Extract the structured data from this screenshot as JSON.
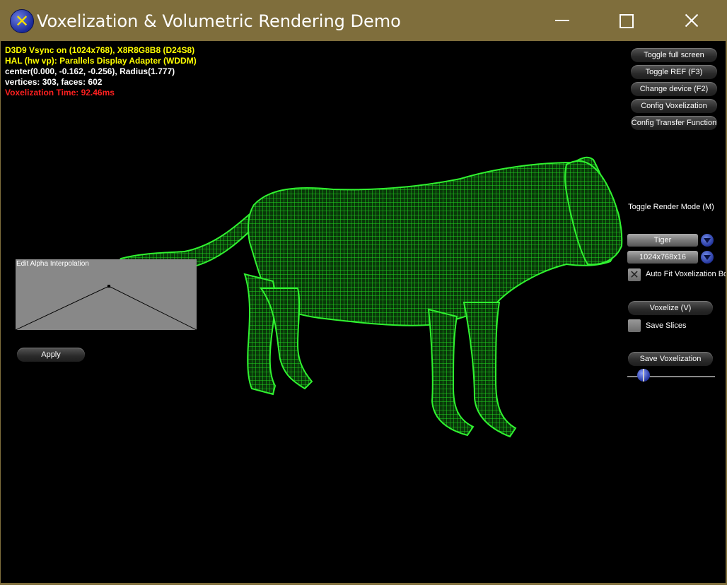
{
  "window": {
    "title": "Voxelization & Volumetric Rendering Demo",
    "icon": "directx-sdk-icon",
    "controls": {
      "minimize": "minimize-icon",
      "maximize": "maximize-icon",
      "close": "close-icon"
    }
  },
  "stats": {
    "device": "D3D9 Vsync on (1024x768), X8R8G8B8 (D24S8)",
    "adapter": "HAL (hw vp): Parallels Display Adapter (WDDM)",
    "bounds": "center(0.000, -0.162, -0.256), Radius(1.777)",
    "geometry": "vertices: 303, faces: 602",
    "voxel_time": "Voxelization Time: 92.46ms"
  },
  "panel": {
    "toggle_fullscreen": "Toggle full screen",
    "toggle_ref": "Toggle REF (F3)",
    "change_device": "Change device (F2)",
    "config_voxelization": "Config Voxelization",
    "config_transfer": "Config Transfer Function",
    "toggle_render_mode": "Toggle Render Mode (M)",
    "model_select": "Tiger",
    "resolution_select": "1024x768x16",
    "auto_fit_label": "Auto Fit Voxelization Bo",
    "auto_fit_checked": true,
    "voxelize": "Voxelize (V)",
    "save_slices_label": "Save Slices",
    "save_slices_checked": false,
    "save_voxelization": "Save Voxelization",
    "slider_value": 0.2
  },
  "alpha_editor": {
    "title": "Edit Alpha Interpolation",
    "apply": "Apply"
  },
  "colors": {
    "titlebar": "#7f6e3c",
    "voxel_green": "#22ff22",
    "stats_yellow": "#ffff00",
    "stats_red": "#ff2020"
  }
}
